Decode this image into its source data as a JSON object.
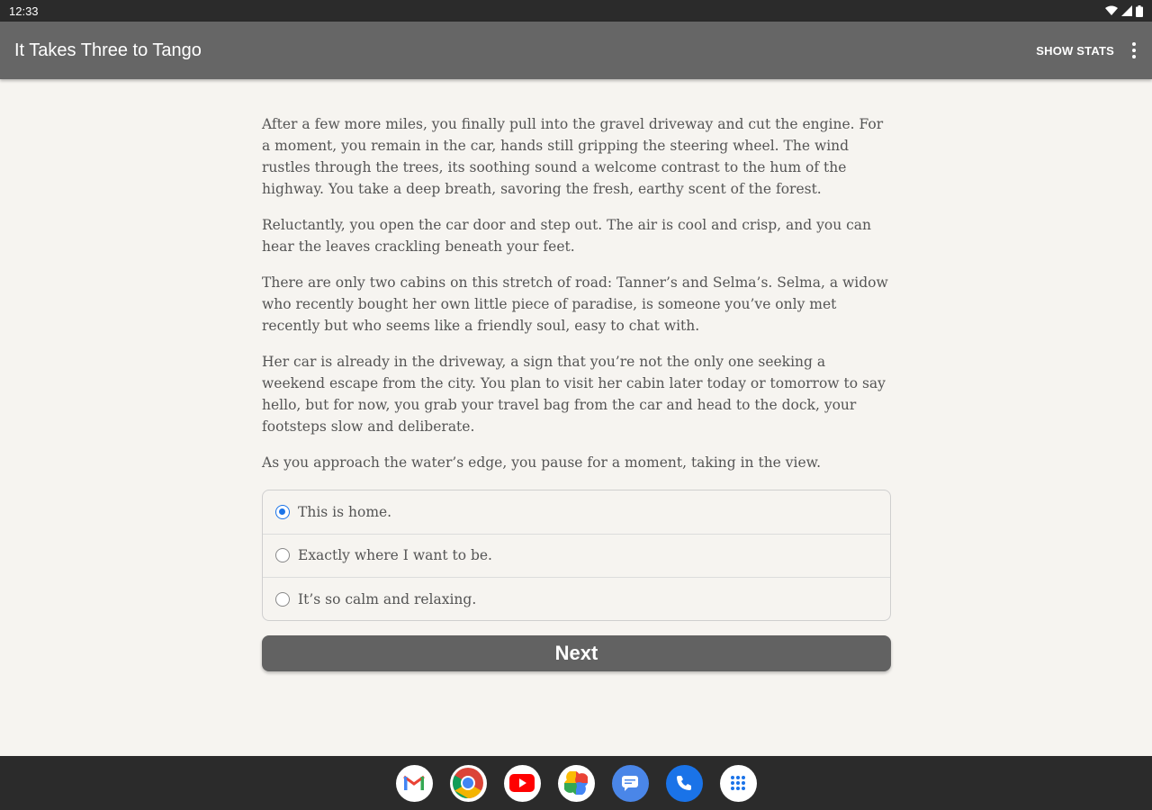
{
  "status_bar": {
    "time": "12:33"
  },
  "app_bar": {
    "title": "It Takes Three to Tango",
    "show_stats_label": "SHOW STATS"
  },
  "story": {
    "paragraphs": [
      "After a few more miles, you finally pull into the gravel driveway and cut the engine. For a moment, you remain in the car, hands still gripping the steering wheel. The wind rustles through the trees, its soothing sound a welcome contrast to the hum of the highway. You take a deep breath, savoring the fresh, earthy scent of the forest.",
      "Reluctantly, you open the car door and step out. The air is cool and crisp, and you can hear the leaves crackling beneath your feet.",
      "There are only two cabins on this stretch of road: Tanner’s and Selma’s. Selma, a widow who recently bought her own little piece of paradise, is someone you’ve only met recently but who seems like a friendly soul, easy to chat with.",
      "Her car is already in the driveway, a sign that you’re not the only one seeking a weekend escape from the city. You plan to visit her cabin later today or tomorrow to say hello, but for now, you grab your travel bag from the car and head to the dock, your footsteps slow and deliberate.",
      "As you approach the water’s edge, you pause for a moment, taking in the view."
    ]
  },
  "choices": [
    {
      "label": "This is home.",
      "selected": true
    },
    {
      "label": "Exactly where I want to be.",
      "selected": false
    },
    {
      "label": "It’s so calm and relaxing.",
      "selected": false
    }
  ],
  "next_button": {
    "label": "Next"
  },
  "dock": {
    "apps": [
      "gmail-icon",
      "chrome-icon",
      "youtube-icon",
      "photos-icon",
      "messages-icon",
      "phone-icon",
      "app-drawer-icon"
    ]
  },
  "colors": {
    "app_bar": "#666666",
    "background": "#f6f4f0",
    "radio_accent": "#1a73e8",
    "next_button": "#626262"
  }
}
